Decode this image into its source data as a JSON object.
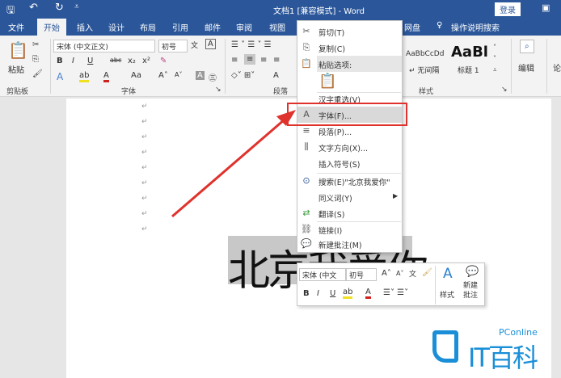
{
  "titlebar": {
    "title": "文档1 [兼容模式] - Word",
    "login": "登录"
  },
  "tabs": [
    "文件",
    "开始",
    "插入",
    "设计",
    "布局",
    "引用",
    "邮件",
    "审阅",
    "视图",
    "网盘",
    "操作说明搜索"
  ],
  "ribbon": {
    "clipboard": {
      "paste": "粘贴",
      "label": "剪贴板"
    },
    "font": {
      "name": "宋体 (中文正文)",
      "size": "初号",
      "bold": "B",
      "italic": "I",
      "underline": "U",
      "strike": "abc",
      "sub": "x₂",
      "sup": "x²",
      "grow": "A˄",
      "shrink": "A˅",
      "case": "Aa",
      "color": "A",
      "label": "字体"
    },
    "paragraph": {
      "label": "段落"
    },
    "styles": {
      "items": [
        {
          "preview": "AaBbCcDd",
          "name": "↵ 无间隔"
        },
        {
          "preview": "AaBl",
          "name": "标题 1"
        }
      ],
      "label": "样式"
    },
    "editing": {
      "label": "编辑"
    },
    "extra": {
      "label": "论"
    }
  },
  "document": {
    "selected_text": "北京我爱你",
    "para_mark": "↵"
  },
  "context_menu": {
    "items": [
      {
        "icon": "✂",
        "label": "剪切(T)"
      },
      {
        "icon": "⎘",
        "label": "复制(C)"
      },
      {
        "icon": "📋",
        "label": "粘贴选项:"
      },
      {
        "icon": "",
        "label": "汉字重选(V)"
      },
      {
        "icon": "A",
        "label": "字体(F)..."
      },
      {
        "icon": "≡",
        "label": "段落(P)..."
      },
      {
        "icon": "⫼",
        "label": "文字方向(X)..."
      },
      {
        "icon": "",
        "label": "插入符号(S)"
      },
      {
        "icon": "⊙",
        "label": "搜索(E)\"北京我爱你\""
      },
      {
        "icon": "",
        "label": "同义词(Y)"
      },
      {
        "icon": "⇄",
        "label": "翻译(S)"
      },
      {
        "icon": "⛓",
        "label": "链接(I)"
      },
      {
        "icon": "💬",
        "label": "新建批注(M)"
      }
    ]
  },
  "mini_toolbar": {
    "font": "宋体 (中文",
    "size": "初号",
    "styles": "样式",
    "new_comment": "新建批注",
    "bold": "B",
    "italic": "I",
    "underline": "U"
  },
  "watermark": {
    "brand": "PConline",
    "name": "IT百科"
  },
  "colors": {
    "word_blue": "#2b579a",
    "highlight_red": "#e0322c",
    "logo_blue": "#1a8fd8"
  }
}
